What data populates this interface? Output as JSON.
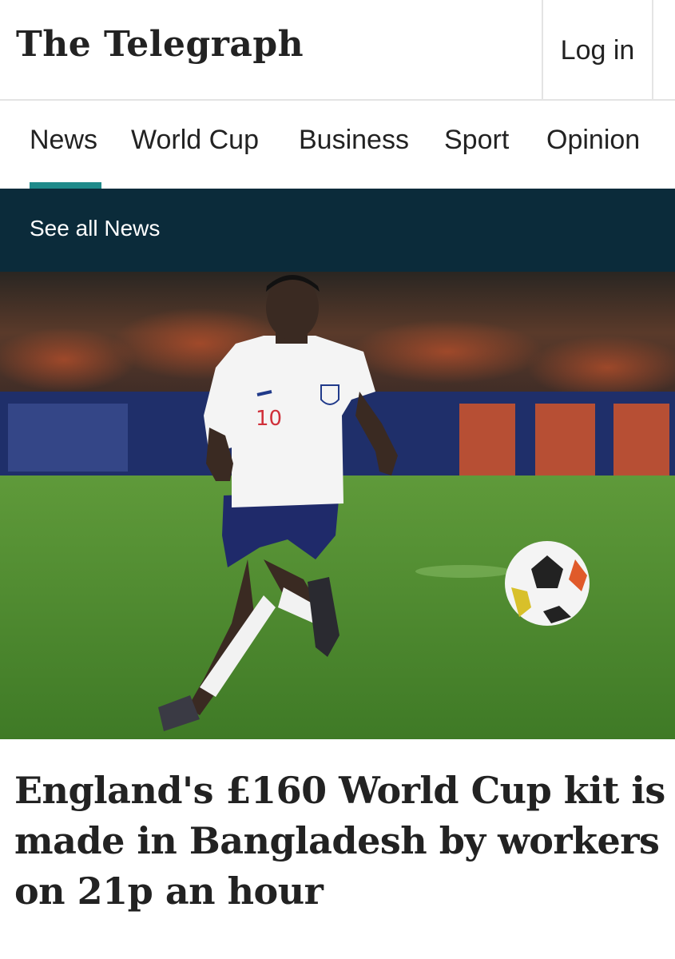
{
  "header": {
    "logo_text": "The Telegraph",
    "login_label": "Log in"
  },
  "nav": {
    "items": [
      {
        "label": "News",
        "active": true
      },
      {
        "label": "World Cup",
        "active": false
      },
      {
        "label": "Business",
        "active": false
      },
      {
        "label": "Sport",
        "active": false
      },
      {
        "label": "Opinion",
        "active": false
      }
    ],
    "active_color": "#1f8a8a"
  },
  "subnav": {
    "link_label": "See all News",
    "background": "#0b2b3a"
  },
  "article": {
    "image_alt": "England footballer in white kit number 10 running towards a football on a pitch",
    "shirt_number": "10",
    "headline": "England's £160 World Cup kit is made in Bangladesh by workers on 21p an hour"
  }
}
